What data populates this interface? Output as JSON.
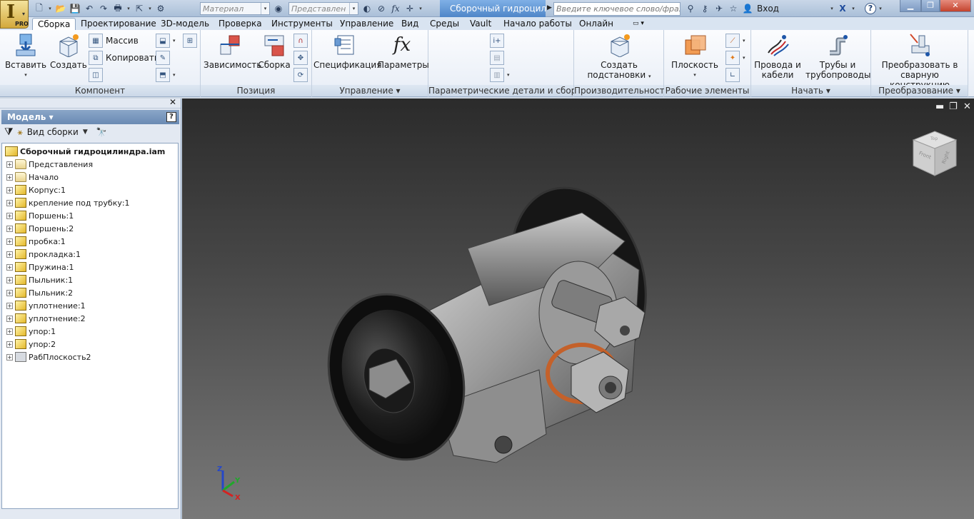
{
  "app": {
    "logo_letter": "I",
    "edition": "PRO",
    "document_tab": "Сборочный гидроцил...",
    "material_combo": "Материал",
    "representation_combo": "Представлен",
    "search_placeholder": "Введите ключевое слово/фразу",
    "signin": "Вход",
    "help": "?"
  },
  "tabs": [
    "Сборка",
    "Проектирование",
    "3D-модель",
    "Проверка",
    "Инструменты",
    "Управление",
    "Вид",
    "Среды",
    "Vault",
    "Начало работы",
    "Онлайн"
  ],
  "ribbon": {
    "component": {
      "title": "Компонент",
      "insert": "Вставить",
      "create": "Создать",
      "pattern": "Массив",
      "copy": "Копировать"
    },
    "position": {
      "title": "Позиция",
      "constrain": "Зависимость",
      "assemble": "Сборка"
    },
    "manage": {
      "title": "Управление",
      "bom": "Спецификация",
      "params": "Параметры"
    },
    "ipart": {
      "title": "Параметрические детали и сборки"
    },
    "productivity": {
      "title": "Производительность",
      "create_sub_1": "Создать",
      "create_sub_2": "подстановки"
    },
    "work_features": {
      "title": "Рабочие элементы",
      "plane": "Плоскость"
    },
    "begin": {
      "title": "Начать",
      "cable_1": "Провода и",
      "cable_2": "кабели",
      "tube_1": "Трубы и",
      "tube_2": "трубопроводы"
    },
    "convert": {
      "title": "Преобразование",
      "weld_1": "Преобразовать в",
      "weld_2": "сварную конструкцию"
    }
  },
  "browser": {
    "title": "Модель",
    "view_mode": "Вид сборки",
    "root": "Сборочный гидроцилиндра.iam",
    "items": [
      {
        "label": "Представления",
        "icon": "representations-icon"
      },
      {
        "label": "Начало",
        "icon": "folder-icon"
      },
      {
        "label": "Корпус:1",
        "icon": "grounded-part-icon"
      },
      {
        "label": "крепление под трубку:1",
        "icon": "part-icon"
      },
      {
        "label": "Поршень:1",
        "icon": "part-icon"
      },
      {
        "label": "Поршень:2",
        "icon": "part-icon"
      },
      {
        "label": "пробка:1",
        "icon": "part-icon"
      },
      {
        "label": "прокладка:1",
        "icon": "part-icon"
      },
      {
        "label": "Пружина:1",
        "icon": "part-icon"
      },
      {
        "label": "Пыльник:1",
        "icon": "part-icon"
      },
      {
        "label": "Пыльник:2",
        "icon": "part-icon"
      },
      {
        "label": "уплотнение:1",
        "icon": "part-icon"
      },
      {
        "label": "уплотнение:2",
        "icon": "part-icon"
      },
      {
        "label": "упор:1",
        "icon": "part-icon"
      },
      {
        "label": "упор:2",
        "icon": "part-icon"
      },
      {
        "label": "РабПлоскость2",
        "icon": "work-plane-icon"
      }
    ]
  },
  "viewcube": {
    "face_front": "Front",
    "face_right": "Right",
    "face_top": "Top"
  },
  "triad": {
    "x": "X",
    "y": "Y",
    "z": "Z"
  }
}
